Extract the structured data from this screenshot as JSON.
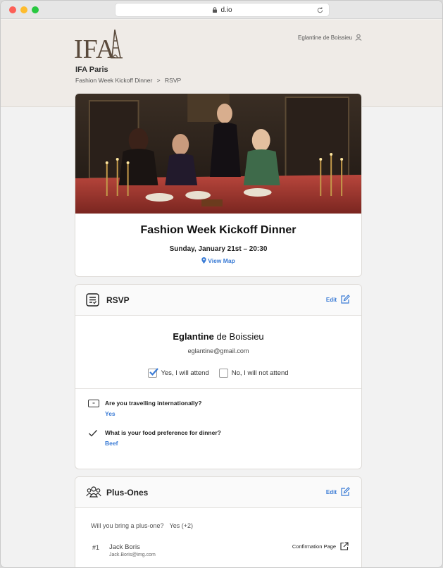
{
  "browser": {
    "url": "d.io"
  },
  "header": {
    "logo_text": "IFA",
    "org_name": "IFA Paris",
    "breadcrumb": [
      "Fashion Week Kickoff Dinner",
      ">",
      "RSVP"
    ],
    "user_name": "Eglantine de Boissieu"
  },
  "event": {
    "title": "Fashion Week Kickoff Dinner",
    "datetime": "Sunday, January 21st – 20:30",
    "map_link": "View Map"
  },
  "rsvp": {
    "title": "RSVP",
    "edit_label": "Edit",
    "guest_first": "Eglantine",
    "guest_last": " de Boissieu",
    "guest_email": "eglantine@gmail.com",
    "attend_yes": "Yes, I will attend",
    "attend_no": "No, I will not attend",
    "attend_selected": "yes",
    "questions": [
      {
        "text": "Are you travelling internationally?",
        "answer": "Yes",
        "icon": "dropdown-icon"
      },
      {
        "text": "What is your food preference for dinner?",
        "answer": "Beef",
        "icon": "checkmark-icon"
      }
    ]
  },
  "plus_ones": {
    "title": "Plus-Ones",
    "edit_label": "Edit",
    "question": "Will you bring a plus-one?",
    "answer": "Yes (+2)",
    "guests": [
      {
        "number": "#1",
        "name": "Jack Boris",
        "email": "Jack.Boris@img.com",
        "link": "Confirmation Page"
      }
    ]
  },
  "colors": {
    "accent": "#3a7bd5",
    "logo": "#5a4a3c",
    "header_bg": "#efebe7"
  }
}
